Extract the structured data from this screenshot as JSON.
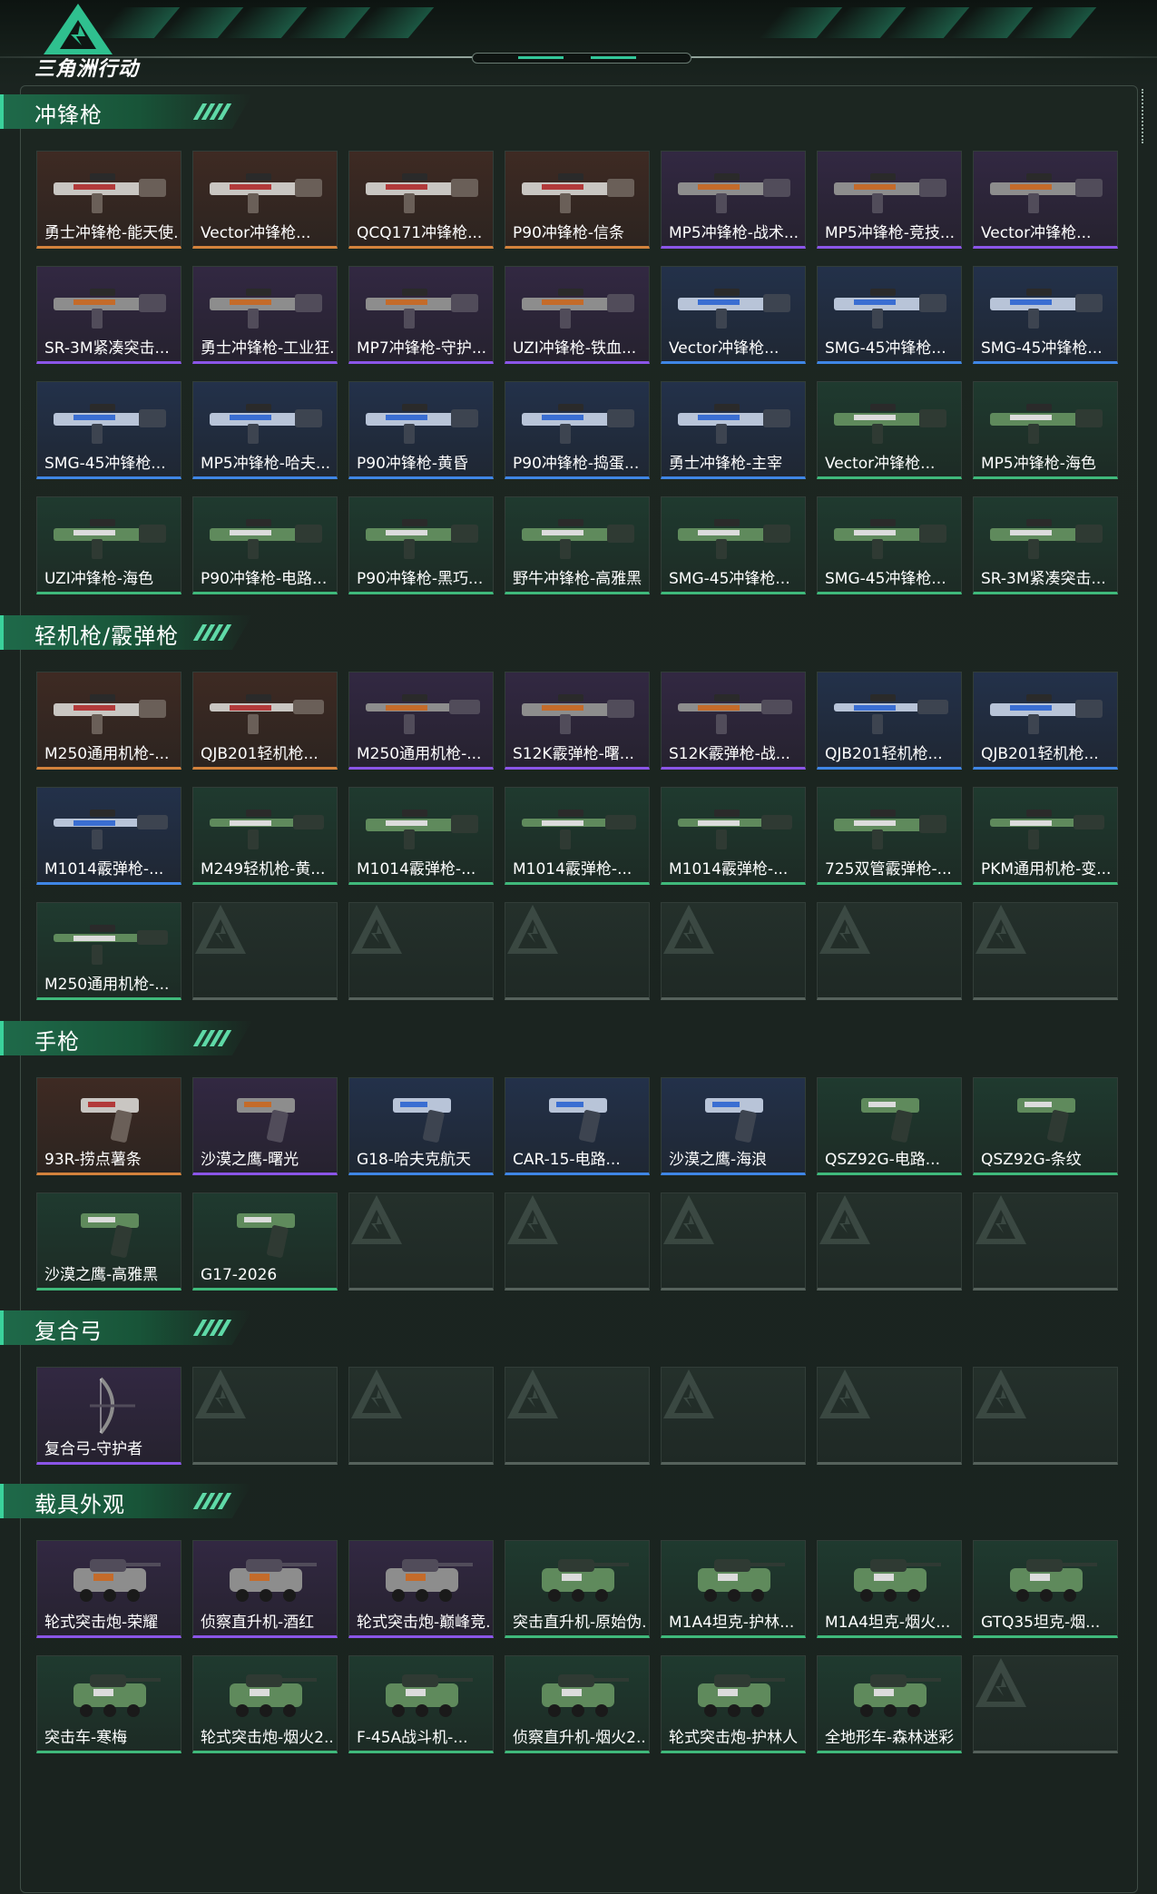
{
  "app": {
    "logo_text": "三角洲行动"
  },
  "sections": [
    {
      "title": "冲锋枪",
      "items": [
        {
          "label": "勇士冲锋枪-能天使...",
          "quality": "orange"
        },
        {
          "label": "Vector冲锋枪...",
          "quality": "orange"
        },
        {
          "label": "QCQ171冲锋枪...",
          "quality": "orange"
        },
        {
          "label": "P90冲锋枪-信条",
          "quality": "orange"
        },
        {
          "label": "MP5冲锋枪-战术...",
          "quality": "purple"
        },
        {
          "label": "MP5冲锋枪-竞技...",
          "quality": "purple"
        },
        {
          "label": "Vector冲锋枪...",
          "quality": "purple"
        },
        {
          "label": "SR-3M紧凑突击...",
          "quality": "purple"
        },
        {
          "label": "勇士冲锋枪-工业狂...",
          "quality": "purple"
        },
        {
          "label": "MP7冲锋枪-守护...",
          "quality": "purple"
        },
        {
          "label": "UZI冲锋枪-铁血...",
          "quality": "purple"
        },
        {
          "label": "Vector冲锋枪...",
          "quality": "blue"
        },
        {
          "label": "SMG-45冲锋枪...",
          "quality": "blue"
        },
        {
          "label": "SMG-45冲锋枪...",
          "quality": "blue"
        },
        {
          "label": "SMG-45冲锋枪...",
          "quality": "blue"
        },
        {
          "label": "MP5冲锋枪-哈夫...",
          "quality": "blue"
        },
        {
          "label": "P90冲锋枪-黄昏",
          "quality": "blue"
        },
        {
          "label": "P90冲锋枪-捣蛋...",
          "quality": "blue"
        },
        {
          "label": "勇士冲锋枪-主宰",
          "quality": "blue"
        },
        {
          "label": "Vector冲锋枪...",
          "quality": "green"
        },
        {
          "label": "MP5冲锋枪-海色",
          "quality": "green"
        },
        {
          "label": "UZI冲锋枪-海色",
          "quality": "green"
        },
        {
          "label": "P90冲锋枪-电路...",
          "quality": "green"
        },
        {
          "label": "P90冲锋枪-黑巧...",
          "quality": "green"
        },
        {
          "label": "野牛冲锋枪-高雅黑",
          "quality": "green"
        },
        {
          "label": "SMG-45冲锋枪...",
          "quality": "green"
        },
        {
          "label": "SMG-45冲锋枪...",
          "quality": "green"
        },
        {
          "label": "SR-3M紧凑突击...",
          "quality": "green"
        }
      ]
    },
    {
      "title": "轻机枪/霰弹枪",
      "items": [
        {
          "label": "M250通用机枪-...",
          "quality": "orange"
        },
        {
          "label": "QJB201轻机枪...",
          "quality": "orange"
        },
        {
          "label": "M250通用机枪-...",
          "quality": "purple"
        },
        {
          "label": "S12K霰弹枪-曙...",
          "quality": "purple"
        },
        {
          "label": "S12K霰弹枪-战...",
          "quality": "purple"
        },
        {
          "label": "QJB201轻机枪...",
          "quality": "blue"
        },
        {
          "label": "QJB201轻机枪...",
          "quality": "blue"
        },
        {
          "label": "M1014霰弹枪-...",
          "quality": "blue"
        },
        {
          "label": "M249轻机枪-黄...",
          "quality": "green"
        },
        {
          "label": "M1014霰弹枪-...",
          "quality": "green"
        },
        {
          "label": "M1014霰弹枪-...",
          "quality": "green"
        },
        {
          "label": "M1014霰弹枪-...",
          "quality": "green"
        },
        {
          "label": "725双管霰弹枪-...",
          "quality": "green"
        },
        {
          "label": "PKM通用机枪-变...",
          "quality": "green"
        },
        {
          "label": "M250通用机枪-...",
          "quality": "green"
        },
        {
          "label": "",
          "quality": "empty"
        },
        {
          "label": "",
          "quality": "empty"
        },
        {
          "label": "",
          "quality": "empty"
        },
        {
          "label": "",
          "quality": "empty"
        },
        {
          "label": "",
          "quality": "empty"
        },
        {
          "label": "",
          "quality": "empty"
        }
      ]
    },
    {
      "title": "手枪",
      "items": [
        {
          "label": "93R-捞点薯条",
          "quality": "orange"
        },
        {
          "label": "沙漠之鹰-曙光",
          "quality": "purple"
        },
        {
          "label": "G18-哈夫克航天",
          "quality": "blue"
        },
        {
          "label": "CAR-15-电路...",
          "quality": "blue"
        },
        {
          "label": "沙漠之鹰-海浪",
          "quality": "blue"
        },
        {
          "label": "QSZ92G-电路...",
          "quality": "green"
        },
        {
          "label": "QSZ92G-条纹",
          "quality": "green"
        },
        {
          "label": "沙漠之鹰-高雅黑",
          "quality": "green"
        },
        {
          "label": "G17-2026",
          "quality": "green"
        },
        {
          "label": "",
          "quality": "empty"
        },
        {
          "label": "",
          "quality": "empty"
        },
        {
          "label": "",
          "quality": "empty"
        },
        {
          "label": "",
          "quality": "empty"
        },
        {
          "label": "",
          "quality": "empty"
        }
      ]
    },
    {
      "title": "复合弓",
      "items": [
        {
          "label": "复合弓-守护者",
          "quality": "purple"
        },
        {
          "label": "",
          "quality": "empty"
        },
        {
          "label": "",
          "quality": "empty"
        },
        {
          "label": "",
          "quality": "empty"
        },
        {
          "label": "",
          "quality": "empty"
        },
        {
          "label": "",
          "quality": "empty"
        },
        {
          "label": "",
          "quality": "empty"
        }
      ]
    },
    {
      "title": "载具外观",
      "items": [
        {
          "label": "轮式突击炮-荣耀",
          "quality": "purple"
        },
        {
          "label": "侦察直升机-酒红",
          "quality": "purple"
        },
        {
          "label": "轮式突击炮-巅峰竞...",
          "quality": "purple"
        },
        {
          "label": "突击直升机-原始伪...",
          "quality": "green"
        },
        {
          "label": "M1A4坦克-护林...",
          "quality": "green"
        },
        {
          "label": "M1A4坦克-烟火...",
          "quality": "green"
        },
        {
          "label": "GTQ35坦克-烟...",
          "quality": "green"
        },
        {
          "label": "突击车-寒梅",
          "quality": "green"
        },
        {
          "label": "轮式突击炮-烟火2...",
          "quality": "green"
        },
        {
          "label": "F-45A战斗机-...",
          "quality": "green"
        },
        {
          "label": "侦察直升机-烟火2...",
          "quality": "green"
        },
        {
          "label": "轮式突击炮-护林人",
          "quality": "green"
        },
        {
          "label": "全地形车-森林迷彩",
          "quality": "green"
        },
        {
          "label": "",
          "quality": "empty"
        }
      ]
    }
  ],
  "colors": {
    "orange": "#d3823c",
    "purple": "#8b55e8",
    "blue": "#3f86e6",
    "green": "#3fb97b",
    "accent": "#3ad29b"
  }
}
